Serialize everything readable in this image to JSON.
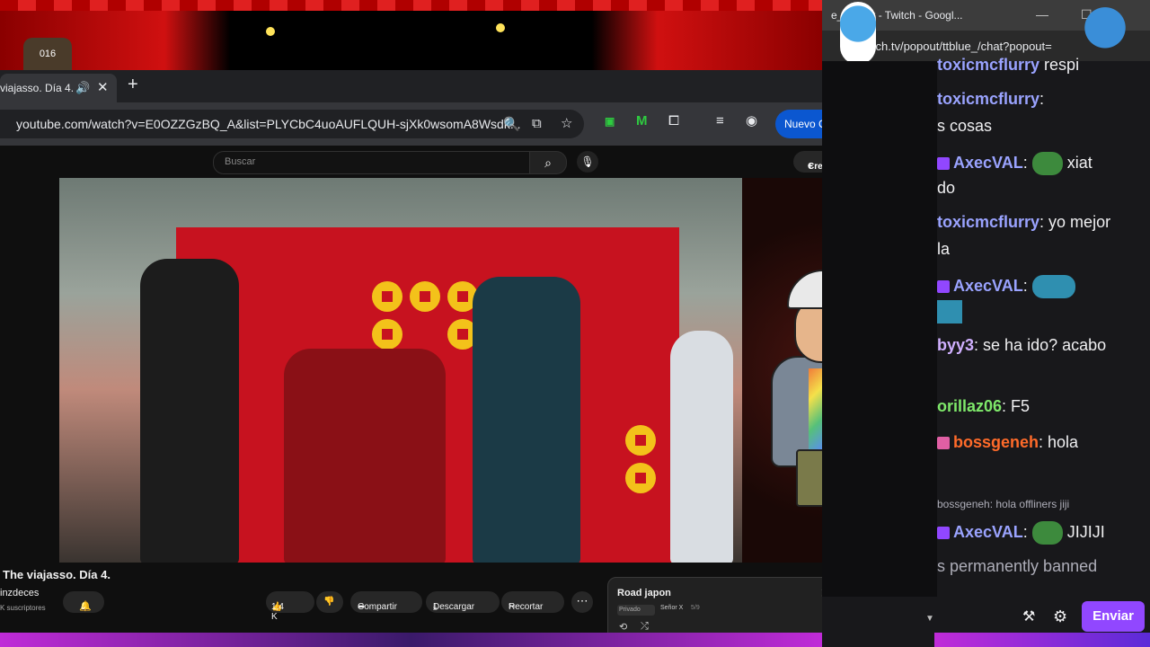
{
  "stream_overlay": {
    "cat_label": "016"
  },
  "browser": {
    "tab_title": "viajasso. Día 4.",
    "tab_audio_icon": "speaker-icon",
    "new_tab_label": "+",
    "url": "youtube.com/watch?v=E0OZZGzBQ_A&list=PLYCbC4uoAUFLQUH-sjXk0wsomA8Wsdk...",
    "update_button": "Nuevo Chrome disponible"
  },
  "youtube": {
    "search_placeholder": "Buscar",
    "create_label": "Crear",
    "video_title": "The viajasso. Día 4.",
    "channel_name": "inzdeces",
    "subscribers": "K suscriptores",
    "likes": "1,4 K",
    "share_label": "Compartir",
    "download_label": "Descargar",
    "clip_label": "Recortar",
    "playlist": {
      "title": "Road japon",
      "privacy": "Privado",
      "owner": "Señor X",
      "position": "5/9"
    }
  },
  "chat": {
    "window_title": "e_ - Chat - Twitch - Googl...",
    "url": "twitch.tv/popout/ttblue_/chat?popout=",
    "messages": [
      {
        "user": "toxicmcflurry",
        "text": " respi"
      },
      {
        "user": "toxicmcflurry",
        "text": ":",
        "cont": "s cosas"
      },
      {
        "user": "AxecVAL",
        "text": ": ",
        "after": " xiat",
        "cont": "do"
      },
      {
        "user": "toxicmcflurry",
        "text": ": yo mejor",
        "cont": "la"
      },
      {
        "user": "AxecVAL",
        "text": ":"
      },
      {
        "user": "byy3",
        "text": ": se ha ido? acabo"
      },
      {
        "user": "orillaz06",
        "text": ": F5"
      },
      {
        "user": "bossgeneh",
        "text": ": hola"
      },
      {
        "system": "bossgeneh: hola offliners jiji"
      },
      {
        "user": "AxecVAL",
        "text": ": ",
        "after": " JIJIJI"
      },
      {
        "system_large": "s permanently banned"
      }
    ],
    "send_label": "Enviar"
  }
}
